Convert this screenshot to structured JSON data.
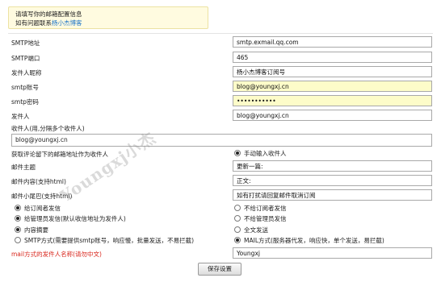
{
  "notice": {
    "line1": "请填写你的邮箱配置信息",
    "line2_prefix": "如有问题联系",
    "line2_link": "杨小杰博客"
  },
  "fields": [
    {
      "label": "SMTP地址",
      "value": "smtp.exmail.qq.com"
    },
    {
      "label": "SMTP端口",
      "value": "465"
    },
    {
      "label": "发件人昵称",
      "value": "杨小杰博客订阅号"
    },
    {
      "label": "smtp账号",
      "value": "blog@youngxj.cn"
    },
    {
      "label": "smtp密码",
      "value": "•••••••••••"
    },
    {
      "label": "发件人",
      "value": "blog@youngxj.cn"
    }
  ],
  "recipient": {
    "label": "收件人(用,分隔多个收件人)",
    "value": "blog@youngxj.cn"
  },
  "comment_option": {
    "label": "获取评论留下的邮箱地址作为收件人",
    "choice": "手动输入收件人"
  },
  "mail_fields": [
    {
      "label": "邮件主题",
      "value": "更新一篇:"
    },
    {
      "label": "邮件内容(支持html)",
      "value": "正文:"
    },
    {
      "label": "邮件小尾巴(支持html)",
      "value": "如有打扰请回复邮件取消订阅"
    }
  ],
  "options": {
    "sub_send": "给订阅者发信",
    "sub_nosend": "不给订阅者发信",
    "admin_send": "给管理员发信(默认收信地址为发件人)",
    "admin_nosend": "不给管理员发信",
    "summary": "内容摘要",
    "full": "全文发送",
    "smtp_mode": "SMTP方式(需要提供smtp账号，响应慢，批量发送，不易拦截)",
    "mail_mode": "MAIL方式(服务器代发，响应快，单个发送，易拦截)"
  },
  "mail_sender": {
    "label": "mail方式的发件人名称(请勿中文)",
    "value": "Youngxj"
  },
  "save_button": "保存设置",
  "watermark": "Youngxj小杰",
  "colors": {
    "link": "#1f76c8",
    "warning_text": "#d9261c",
    "highlight_input": "#fdfcc9",
    "notice_bg": "#fffbe0"
  }
}
